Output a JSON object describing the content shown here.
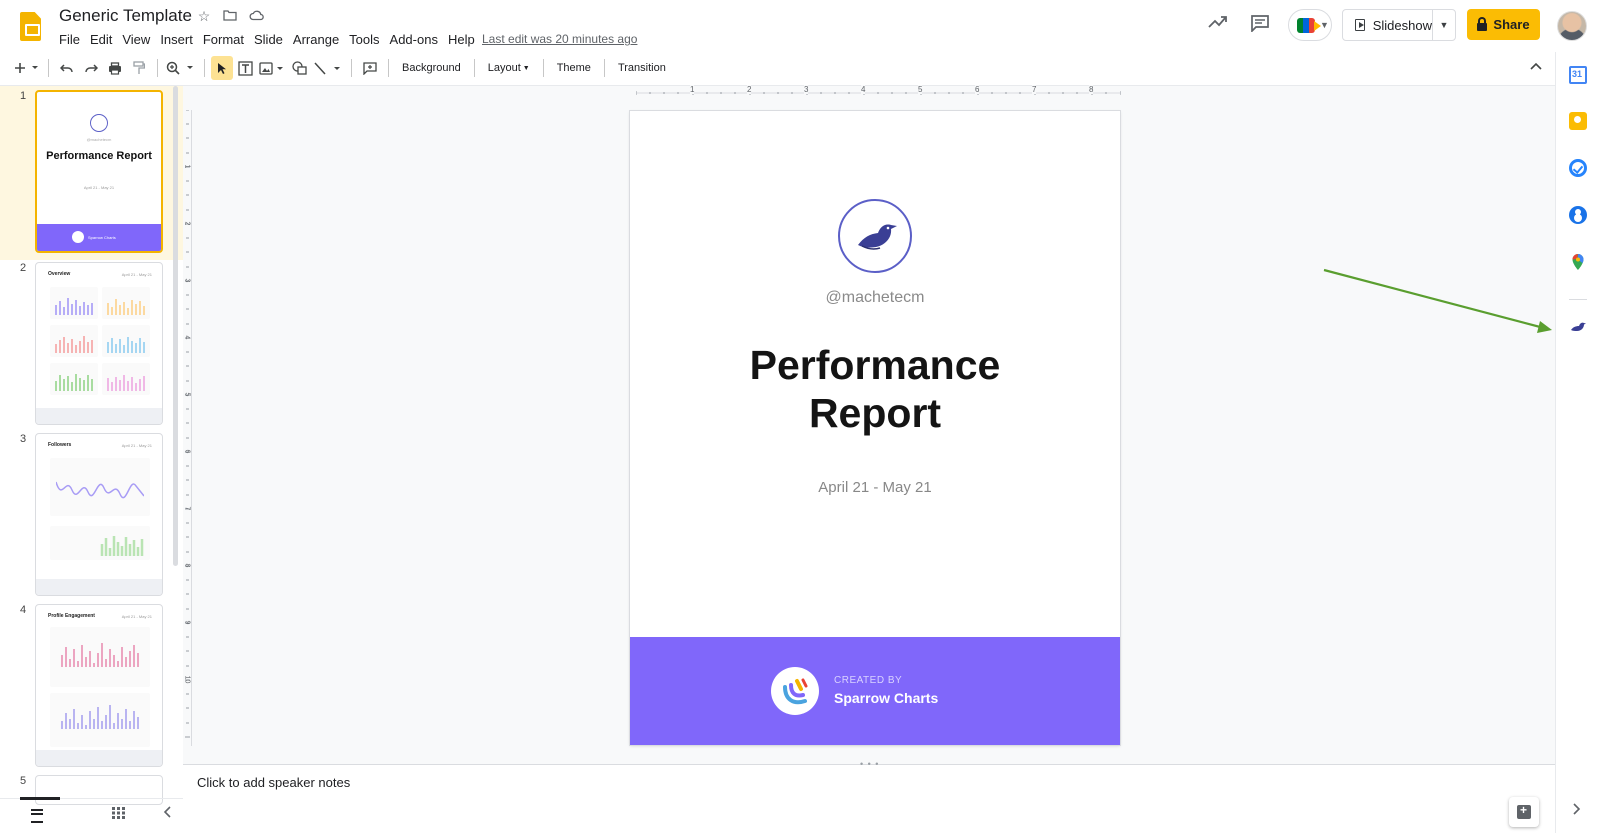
{
  "app": {
    "doc_title": "Generic Template",
    "menu": [
      "File",
      "Edit",
      "View",
      "Insert",
      "Format",
      "Slide",
      "Arrange",
      "Tools",
      "Add-ons",
      "Help"
    ],
    "last_edit": "Last edit was 20 minutes ago",
    "slideshow_label": "Slideshow",
    "share_label": "Share"
  },
  "toolbar": {
    "background_label": "Background",
    "layout_label": "Layout",
    "theme_label": "Theme",
    "transition_label": "Transition",
    "icons": [
      "new-slide-icon",
      "undo-icon",
      "redo-icon",
      "print-icon",
      "paint-format-icon",
      "zoom-icon",
      "select-icon",
      "text-box-icon",
      "image-icon",
      "shape-icon",
      "line-icon",
      "comment-icon"
    ]
  },
  "ruler": {
    "h_labels": [
      "1",
      "2",
      "3",
      "4",
      "5",
      "6",
      "7",
      "8"
    ],
    "v_labels": [
      "1",
      "2",
      "3",
      "4",
      "5",
      "6",
      "7",
      "8",
      "9",
      "10"
    ]
  },
  "filmstrip": {
    "numbers": [
      "1",
      "2",
      "3",
      "4",
      "5"
    ],
    "slides": [
      {
        "title": "Performance Report",
        "date": "April 21 - May 21"
      },
      {
        "title": "Overview",
        "date": "April 21 - May 21"
      },
      {
        "title": "Followers",
        "date": "April 21 - May 21"
      },
      {
        "title": "Profile Engagement",
        "date": "April 21 - May 21"
      }
    ]
  },
  "slide": {
    "handle": "@machetecm",
    "title_line1": "Performance",
    "title_line2": "Report",
    "date_range": "April 21 - May 21",
    "footer_created": "CREATED BY",
    "footer_brand": "Sparrow Charts"
  },
  "notes": {
    "placeholder": "Click to add speaker notes"
  },
  "colors": {
    "accent_yellow": "#fbbc04",
    "slide_purple": "#8067fa",
    "annotation_green": "#5a9e2f"
  }
}
